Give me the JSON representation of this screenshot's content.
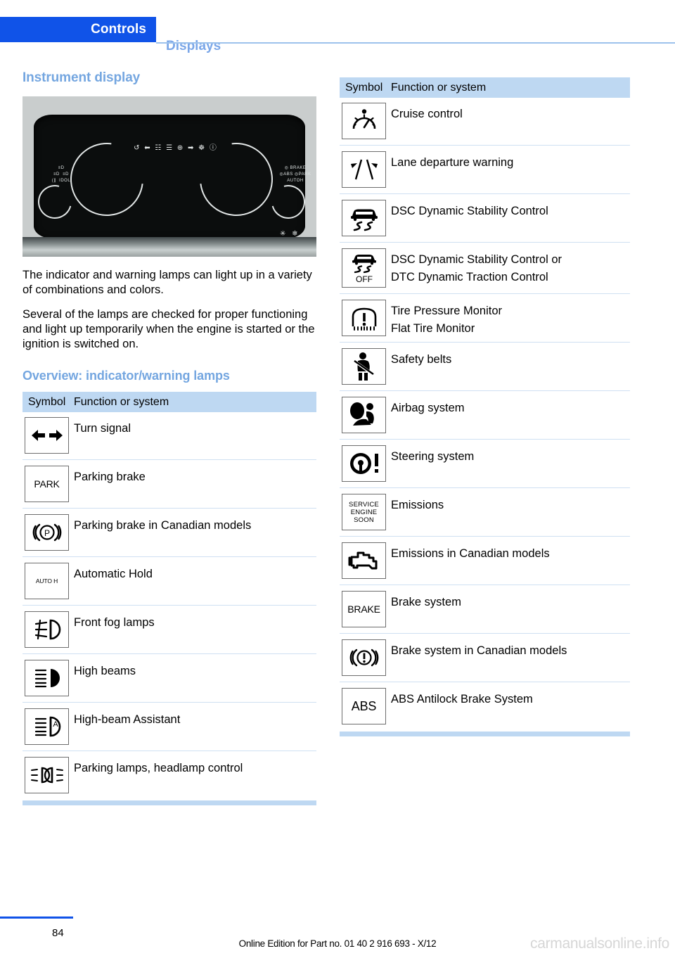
{
  "header": {
    "active_tab": "Controls",
    "inactive_tab": "Displays",
    "accent_color": "#1053e8",
    "inactive_color": "#7ba7e8"
  },
  "left_column": {
    "section_title": "Instrument display",
    "figure": {
      "caption_alt": "instrument-cluster-photo",
      "top_row_glyphs": "↺   ⬅ ☷ ☰ ⊕ ➡ ☸ ⓘ",
      "left_tell_glyphs": "≡D\n≡D  ≡D\n≡C  IDOL",
      "right_tell_glyphs": "◯ BRAKE\n◯ ABS   ◯ PARK\nAUTOH",
      "bottom_right_glyphs": "✳ ❄"
    },
    "paragraphs": [
      "The indicator and warning lamps can light up in a variety of combinations and colors.",
      "Several of the lamps are checked for proper functioning and light up temporarily when the engine is started or the ignition is switched on."
    ],
    "overview_title": "Overview: indicator/warning lamps",
    "table": {
      "headers": {
        "symbol": "Symbol",
        "function": "Function or system"
      },
      "rows": [
        {
          "icon": "turn-signal-icon",
          "label": "Turn signal"
        },
        {
          "icon": "parking-brake-park-icon",
          "label": "Parking brake",
          "icon_text": "PARK"
        },
        {
          "icon": "parking-brake-canada-icon",
          "label": "Parking brake in Canadian models"
        },
        {
          "icon": "automatic-hold-icon",
          "label": "Automatic Hold",
          "icon_text": "AUTO H"
        },
        {
          "icon": "front-fog-lamps-icon",
          "label": "Front fog lamps"
        },
        {
          "icon": "high-beams-icon",
          "label": "High beams"
        },
        {
          "icon": "high-beam-assistant-icon",
          "label": "High-beam Assistant"
        },
        {
          "icon": "parking-lamps-headlamp-control-icon",
          "label": "Parking lamps, headlamp control"
        }
      ]
    }
  },
  "right_column": {
    "table": {
      "headers": {
        "symbol": "Symbol",
        "function": "Function or system"
      },
      "rows": [
        {
          "icon": "cruise-control-icon",
          "label": "Cruise control"
        },
        {
          "icon": "lane-departure-warning-icon",
          "label": "Lane departure warning"
        },
        {
          "icon": "dsc-icon",
          "label": "DSC Dynamic Stability Control"
        },
        {
          "icon": "dsc-dtc-off-icon",
          "label": "DSC Dynamic Stability Control or",
          "label2": "DTC Dynamic Traction Control",
          "icon_text": "OFF"
        },
        {
          "icon": "tire-pressure-monitor-icon",
          "label": "Tire Pressure Monitor",
          "label2": "Flat Tire Monitor"
        },
        {
          "icon": "safety-belts-icon",
          "label": "Safety belts"
        },
        {
          "icon": "airbag-system-icon",
          "label": "Airbag system"
        },
        {
          "icon": "steering-system-icon",
          "label": "Steering system"
        },
        {
          "icon": "service-engine-soon-icon",
          "label": "Emissions",
          "icon_text": "SERVICE ENGINE SOON"
        },
        {
          "icon": "check-engine-icon",
          "label": "Emissions in Canadian models"
        },
        {
          "icon": "brake-system-icon",
          "label": "Brake system",
          "icon_text": "BRAKE"
        },
        {
          "icon": "brake-system-canada-icon",
          "label": "Brake system in Canadian models"
        },
        {
          "icon": "abs-icon",
          "label": "ABS Antilock Brake System",
          "icon_text": "ABS"
        }
      ]
    }
  },
  "footer": {
    "page_number": "84",
    "note": "Online Edition for Part no. 01 40 2 916 693 - X/12",
    "watermark": "carmanualsonline.info"
  }
}
